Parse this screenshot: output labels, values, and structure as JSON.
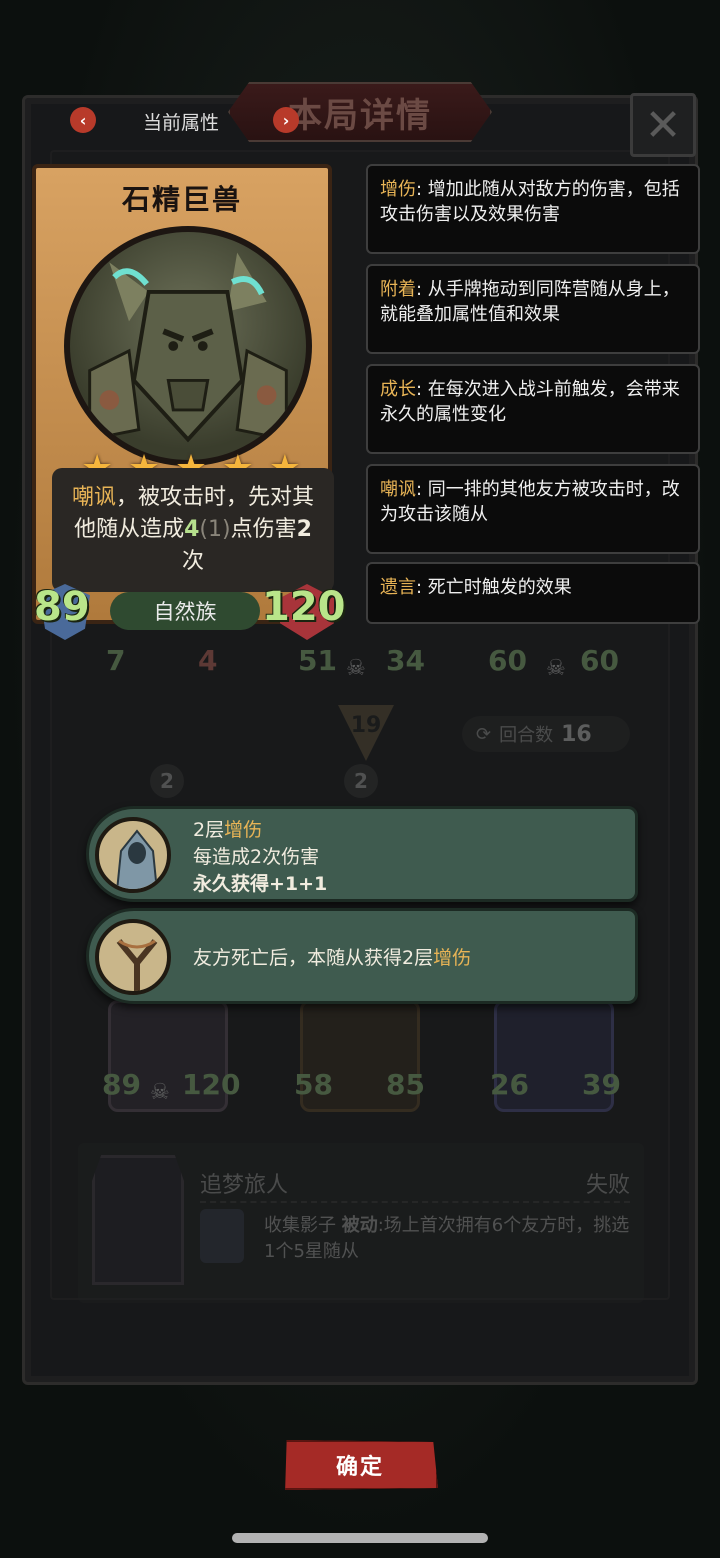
{
  "header": {
    "title": "本局详情",
    "tab_label": "当前属性",
    "prev_icon": "chevron-left-icon",
    "next_icon": "chevron-right-icon",
    "close_icon": "close-icon"
  },
  "hero": {
    "name": "石精巨兽",
    "stars": 5,
    "desc_keyword": "嘲讽",
    "desc_part1": "，被攻击时，先对其他随从造成",
    "desc_dmg": "4",
    "desc_dmg_base": "(1)",
    "desc_part2": "点伤害",
    "desc_times": "2",
    "desc_part3": "次",
    "attack": "89",
    "health": "120",
    "tribe": "自然族"
  },
  "definitions": [
    {
      "keyword": "增伤",
      "text": ": 增加此随从对敌方的伤害，包括攻击伤害以及效果伤害"
    },
    {
      "keyword": "附着",
      "text": ": 从手牌拖动到同阵营随从身上，就能叠加属性值和效果"
    },
    {
      "keyword": "成长",
      "text": ": 在每次进入战斗前触发，会带来永久的属性变化"
    },
    {
      "keyword": "嘲讽",
      "text": ": 同一排的其他友方被攻击时，改为攻击该随从"
    },
    {
      "keyword": "遗言",
      "text": ": 死亡时触发的效果"
    }
  ],
  "board": {
    "top_row": [
      {
        "atk": "7",
        "hp": "4"
      },
      {
        "atk": "51",
        "hp": "34"
      },
      {
        "atk": "60",
        "hp": "60"
      }
    ],
    "turn_marker": "19",
    "rounds_label": "回合数",
    "rounds_value": "16",
    "level_badges": [
      "2",
      "2"
    ],
    "bottom_row": [
      {
        "atk": "89",
        "hp": "120"
      },
      {
        "atk": "58",
        "hp": "85"
      },
      {
        "atk": "26",
        "hp": "39"
      }
    ]
  },
  "popups": [
    {
      "line1_prefix": "2层",
      "line1_kw": "增伤",
      "line2": "每造成2次伤害",
      "line3": "永久获得+1+1",
      "icon": "hooded-figure-icon"
    },
    {
      "text_prefix": "友方死亡后，本随从获得2层",
      "text_kw": "增伤",
      "icon": "slingshot-icon"
    }
  ],
  "enemy": {
    "name": "追梦旅人",
    "result": "失败",
    "skill_name": "收集影子",
    "skill_type": "被动",
    "skill_text": ":场上首次拥有6个友方时，挑选1个5星随从"
  },
  "confirm_label": "确定",
  "colors": {
    "keyword": "#e8b456",
    "highlight": "#b6e08d",
    "popup_bg": "#3f5b4f",
    "confirm_bg": "#a52a26"
  }
}
